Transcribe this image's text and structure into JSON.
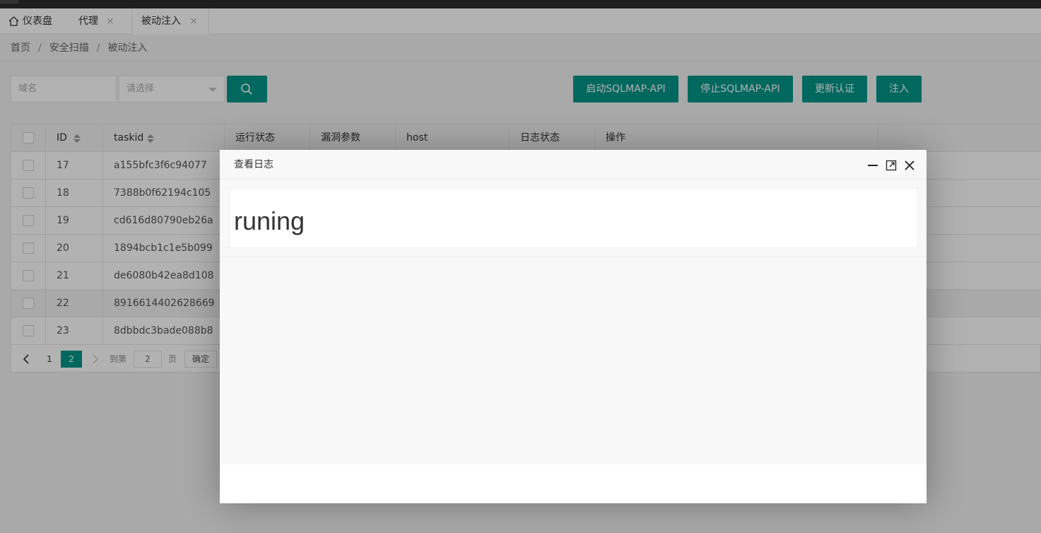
{
  "tabs": [
    {
      "label": "仪表盘",
      "icon": "home-icon"
    },
    {
      "label": "代理",
      "close": "×"
    },
    {
      "label": "被动注入",
      "close": "×",
      "active": true
    }
  ],
  "breadcrumb": {
    "items": [
      "首页",
      "安全扫描",
      "被动注入"
    ],
    "separator": "/"
  },
  "toolbar": {
    "domain_placeholder": "域名",
    "select_placeholder": "请选择",
    "search_icon": "search-icon",
    "buttons": [
      "启动SQLMAP-API",
      "停止SQLMAP-API",
      "更新认证",
      "注入"
    ]
  },
  "table": {
    "headers": [
      "ID",
      "taskid",
      "运行状态",
      "漏洞参数",
      "host",
      "日志状态",
      "操作"
    ],
    "rows": [
      {
        "id": "17",
        "taskid": "a155bfc3f6c94077"
      },
      {
        "id": "18",
        "taskid": "7388b0f62194c105"
      },
      {
        "id": "19",
        "taskid": "cd616d80790eb26a"
      },
      {
        "id": "20",
        "taskid": "1894bcb1c1e5b099"
      },
      {
        "id": "21",
        "taskid": "de6080b42ea8d108"
      },
      {
        "id": "22",
        "taskid": "8916614402628669"
      },
      {
        "id": "23",
        "taskid": "8dbbdc3bade088b8"
      }
    ]
  },
  "pagination": {
    "pages": [
      "1",
      "2"
    ],
    "current": "2",
    "goto_label": "到第",
    "goto_value": "2",
    "page_suffix": "页",
    "confirm_label": "确定"
  },
  "modal": {
    "title": "查看日志",
    "log_text": "runing"
  },
  "colors": {
    "accent": "#009688",
    "topbar": "#2b2b2b",
    "background": "#f2f2f2"
  }
}
